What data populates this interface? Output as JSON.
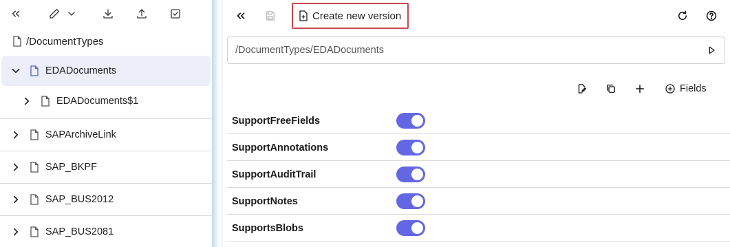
{
  "left_toolbar": {
    "icons": [
      "collapse-left-icon",
      "edit-icon",
      "chevron-down-icon",
      "download-icon",
      "upload-icon",
      "checkbox-icon"
    ]
  },
  "tree": {
    "root_label": "/DocumentTypes",
    "items": [
      {
        "label": "EDADocuments",
        "expanded": true,
        "selected": true
      },
      {
        "label": "EDADocuments$1",
        "expanded": false,
        "child": true
      },
      {
        "label": "SAPArchiveLink",
        "expanded": false
      },
      {
        "label": "SAP_BKPF",
        "expanded": false
      },
      {
        "label": "SAP_BUS2012",
        "expanded": false
      },
      {
        "label": "SAP_BUS2081",
        "expanded": false
      }
    ]
  },
  "toolbar": {
    "create_version_label": "Create new version",
    "icons": [
      "collapse-left-icon",
      "save-icon",
      "refresh-icon",
      "help-icon"
    ]
  },
  "path": {
    "value": "/DocumentTypes/EDADocuments"
  },
  "actions": {
    "fields_label": "Fields",
    "icons": [
      "edit-doc-icon",
      "copy-icon",
      "plus-icon",
      "add-circle-icon"
    ]
  },
  "properties": [
    {
      "label": "SupportFreeFields",
      "enabled": true
    },
    {
      "label": "SupportAnnotations",
      "enabled": true
    },
    {
      "label": "SupportAuditTrail",
      "enabled": true
    },
    {
      "label": "SupportNotes",
      "enabled": true
    },
    {
      "label": "SupportsBlobs",
      "enabled": true
    }
  ],
  "colors": {
    "accent": "#6467e3",
    "selected_row": "#eceffa",
    "highlight_border": "#c9474f"
  }
}
